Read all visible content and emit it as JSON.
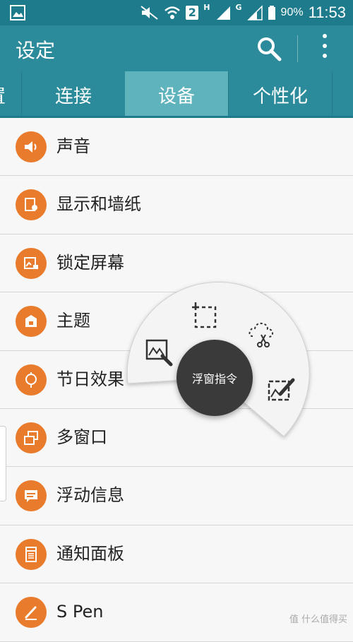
{
  "status_bar": {
    "network_badge": "2",
    "net_h": "H",
    "net_g": "G",
    "battery": "90%",
    "time": "11:53"
  },
  "action_bar": {
    "title": "设定",
    "search_icon": "search-icon",
    "menu_icon": "overflow-menu-icon"
  },
  "tabs": [
    {
      "label": "置",
      "partial": true
    },
    {
      "label": "连接"
    },
    {
      "label": "设备",
      "selected": true
    },
    {
      "label": "个性化"
    },
    {
      "label": "",
      "partial": true
    }
  ],
  "list": [
    {
      "label": "声音",
      "icon": "speaker-icon"
    },
    {
      "label": "显示和墙纸",
      "icon": "display-icon"
    },
    {
      "label": "锁定屏幕",
      "icon": "lock-screen-icon"
    },
    {
      "label": "主题",
      "icon": "theme-icon"
    },
    {
      "label": "节日效果",
      "icon": "lantern-icon"
    },
    {
      "label": "多窗口",
      "icon": "multi-window-icon"
    },
    {
      "label": "浮动信息",
      "icon": "floating-message-icon"
    },
    {
      "label": "通知面板",
      "icon": "notification-panel-icon"
    },
    {
      "label": "S Pen",
      "icon": "pen-icon"
    }
  ],
  "floating_command": {
    "center_label": "浮窗指令",
    "items": [
      "image-clip-icon",
      "smart-select-icon",
      "scrap-booker-icon",
      "screen-write-icon"
    ]
  },
  "watermark": "值 什么值得买",
  "colors": {
    "status_bar": "#1d7b8b",
    "action_bar": "#2b8b9a",
    "tab_selected": "#5fb3bd",
    "icon_orange": "#e97b2c",
    "command_dark": "#3a3a3a"
  }
}
